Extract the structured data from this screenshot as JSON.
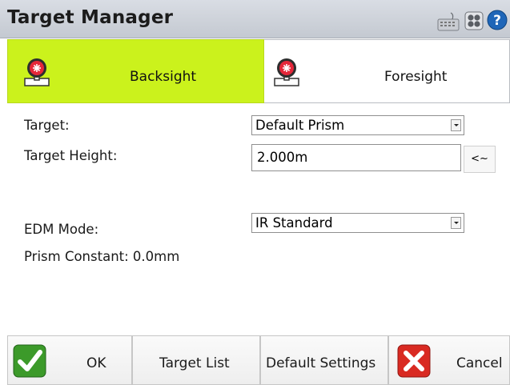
{
  "window": {
    "title": "Target Manager",
    "icons": [
      "keyboard-icon",
      "settings-icon",
      "help-icon"
    ]
  },
  "tabs": [
    {
      "label": "Backsight",
      "icon": "prism-target-icon",
      "active": true
    },
    {
      "label": "Foresight",
      "icon": "prism-target-icon",
      "active": false
    }
  ],
  "form": {
    "target_label": "Target:",
    "target_value": "Default Prism",
    "height_label": "Target Height:",
    "height_value": "2.000m",
    "height_button": "<~",
    "edm_label": "EDM Mode:",
    "edm_value": "IR Standard",
    "prism_constant": "Prism Constant: 0.0mm"
  },
  "buttons": {
    "ok": "OK",
    "target_list": "Target List",
    "default_settings": "Default Settings",
    "cancel": "Cancel"
  },
  "colors": {
    "active_tab": "#cbf21c",
    "ok_icon": "#3c9a2a",
    "cancel_icon": "#d92a22"
  }
}
